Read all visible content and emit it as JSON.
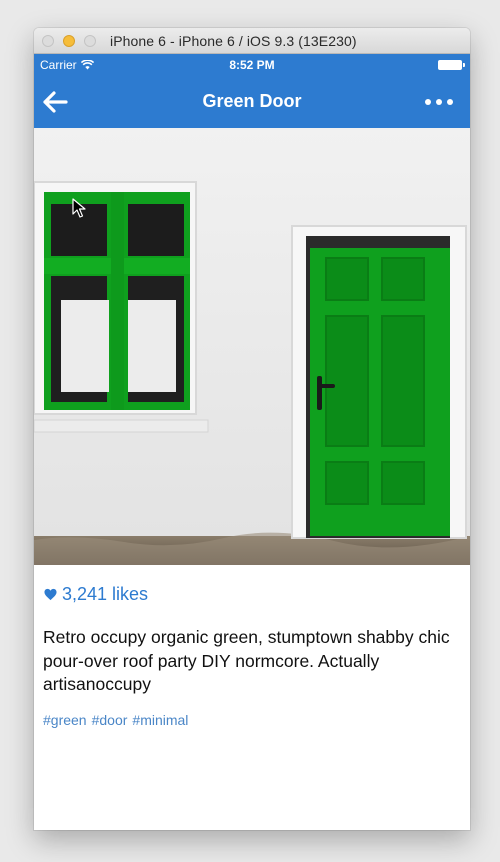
{
  "window": {
    "title": "iPhone 6 - iPhone 6 / iOS 9.3 (13E230)"
  },
  "status_bar": {
    "carrier": "Carrier",
    "time": "8:52 PM",
    "wifi_icon": "wifi-icon",
    "battery_icon": "battery-icon"
  },
  "nav": {
    "title": "Green Door",
    "back_icon": "arrow-left-icon",
    "more_icon": "more-dots-icon"
  },
  "colors": {
    "accent": "#2d7bd0",
    "door_green": "#0fa01e",
    "tag_blue": "#4a86c7"
  },
  "post": {
    "likes": "3,241 likes",
    "caption": "Retro occupy organic green, stumptown shabby chic pour-over roof party DIY normcore. Actually artisanoccupy",
    "tags": [
      "#green",
      "#door",
      "#minimal"
    ]
  }
}
